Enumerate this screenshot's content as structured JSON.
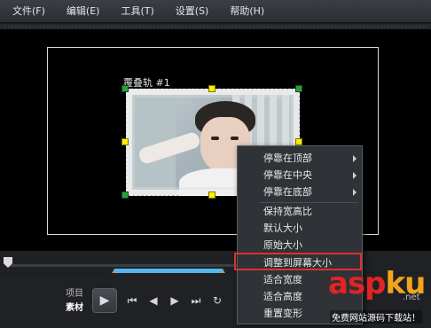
{
  "menubar": {
    "items": [
      "文件(F)",
      "编辑(E)",
      "工具(T)",
      "设置(S)",
      "帮助(H)"
    ]
  },
  "preview": {
    "track_label": "覆叠轨 #1"
  },
  "controls": {
    "mode_project": "项目",
    "mode_clip": "素材"
  },
  "context_menu": {
    "items": [
      {
        "label": "停靠在顶部",
        "has_submenu": true
      },
      {
        "label": "停靠在中央",
        "has_submenu": true
      },
      {
        "label": "停靠在底部",
        "has_submenu": true
      },
      {
        "label": "保持宽高比",
        "has_submenu": false
      },
      {
        "label": "默认大小",
        "has_submenu": false
      },
      {
        "label": "原始大小",
        "has_submenu": false
      },
      {
        "label": "调整到屏幕大小",
        "has_submenu": false,
        "highlighted": true
      },
      {
        "label": "适合宽度",
        "has_submenu": false
      },
      {
        "label": "适合高度",
        "has_submenu": false
      },
      {
        "label": "重置变形",
        "has_submenu": false
      }
    ]
  },
  "watermark": {
    "brand_a": "asp",
    "brand_b": "ku",
    "suffix": ".net",
    "tagline": "免费网站源码下载站！"
  },
  "colors": {
    "highlight_border": "#e03030",
    "handle_yellow": "#ffee00",
    "trim_blue": "#55b6ea"
  }
}
